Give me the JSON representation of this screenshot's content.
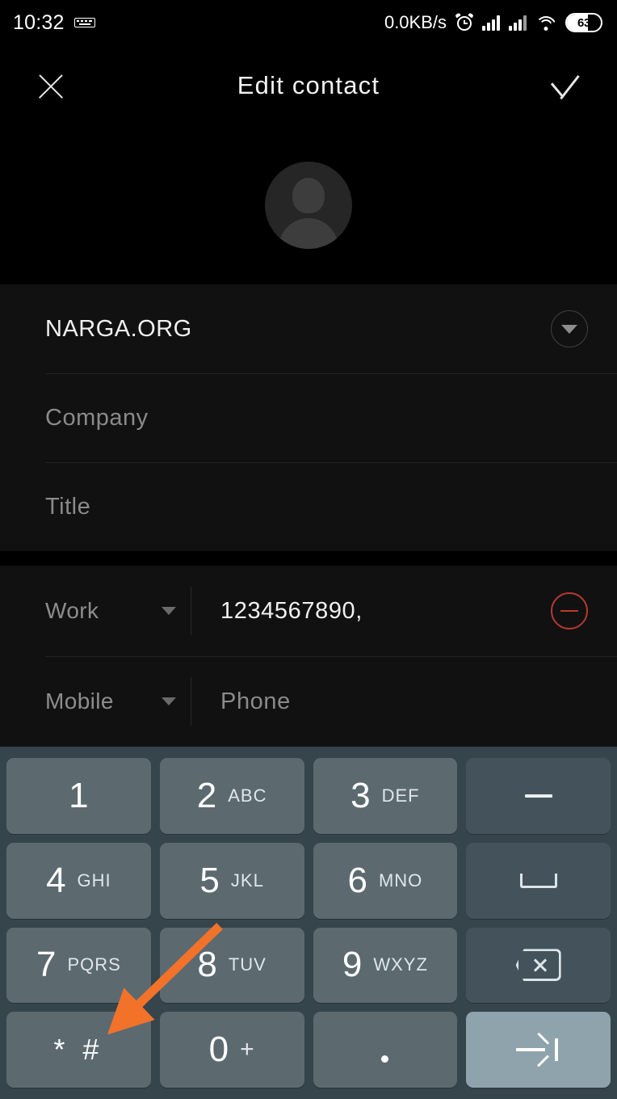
{
  "status_bar": {
    "time": "10:32",
    "keyboard_icon": "keyboard-icon",
    "network_speed": "0.0KB/s",
    "alarm_icon": "alarm-icon",
    "signal_icon_1": "signal-bars-icon",
    "signal_icon_2": "signal-bars-icon",
    "wifi_icon": "wifi-icon",
    "battery_level": "63"
  },
  "app_bar": {
    "close_icon": "close-icon",
    "title": "Edit contact",
    "confirm_icon": "check-icon"
  },
  "avatar": {
    "name": "contact-avatar-placeholder"
  },
  "name_card": {
    "name_value": "NARGA.ORG",
    "expand_icon": "chevron-down-icon",
    "company_placeholder": "Company",
    "title_placeholder": "Title"
  },
  "phone_card": {
    "rows": [
      {
        "type_label": "Work",
        "value": "1234567890,",
        "is_placeholder": false,
        "has_remove": true,
        "remove_icon": "remove-circle-icon"
      },
      {
        "type_label": "Mobile",
        "value": "Phone",
        "is_placeholder": true,
        "has_remove": false,
        "remove_icon": ""
      }
    ]
  },
  "keyboard": {
    "rows": [
      [
        {
          "num": "1",
          "sub": "",
          "kind": "num"
        },
        {
          "num": "2",
          "sub": "ABC",
          "kind": "num"
        },
        {
          "num": "3",
          "sub": "DEF",
          "kind": "num"
        },
        {
          "num": "",
          "sub": "",
          "kind": "dash",
          "icon": "minus-icon"
        }
      ],
      [
        {
          "num": "4",
          "sub": "GHI",
          "kind": "num"
        },
        {
          "num": "5",
          "sub": "JKL",
          "kind": "num"
        },
        {
          "num": "6",
          "sub": "MNO",
          "kind": "num"
        },
        {
          "num": "",
          "sub": "",
          "kind": "space",
          "icon": "space-bar-icon"
        }
      ],
      [
        {
          "num": "7",
          "sub": "PQRS",
          "kind": "num"
        },
        {
          "num": "8",
          "sub": "TUV",
          "kind": "num"
        },
        {
          "num": "9",
          "sub": "WXYZ",
          "kind": "num"
        },
        {
          "num": "",
          "sub": "",
          "kind": "backspace",
          "icon": "backspace-icon"
        }
      ],
      [
        {
          "num": "",
          "sub": "",
          "kind": "sym",
          "sym": "* #"
        },
        {
          "num": "0",
          "sub": "+",
          "kind": "num"
        },
        {
          "num": "",
          "sub": "",
          "kind": "dot",
          "icon": "period-icon"
        },
        {
          "num": "",
          "sub": "",
          "kind": "tab",
          "icon": "next-field-icon"
        }
      ]
    ]
  },
  "annotation": {
    "arrow_color": "#f2722a",
    "points_to": "* #"
  },
  "colors": {
    "background": "#000000",
    "card": "#111112",
    "keyboard_bg": "#36444c",
    "key": "#5c6a70",
    "key_function": "#44535b",
    "key_accent": "#8fa3ac",
    "remove_red": "#c0392b",
    "placeholder_gray": "#8a8a8a"
  }
}
